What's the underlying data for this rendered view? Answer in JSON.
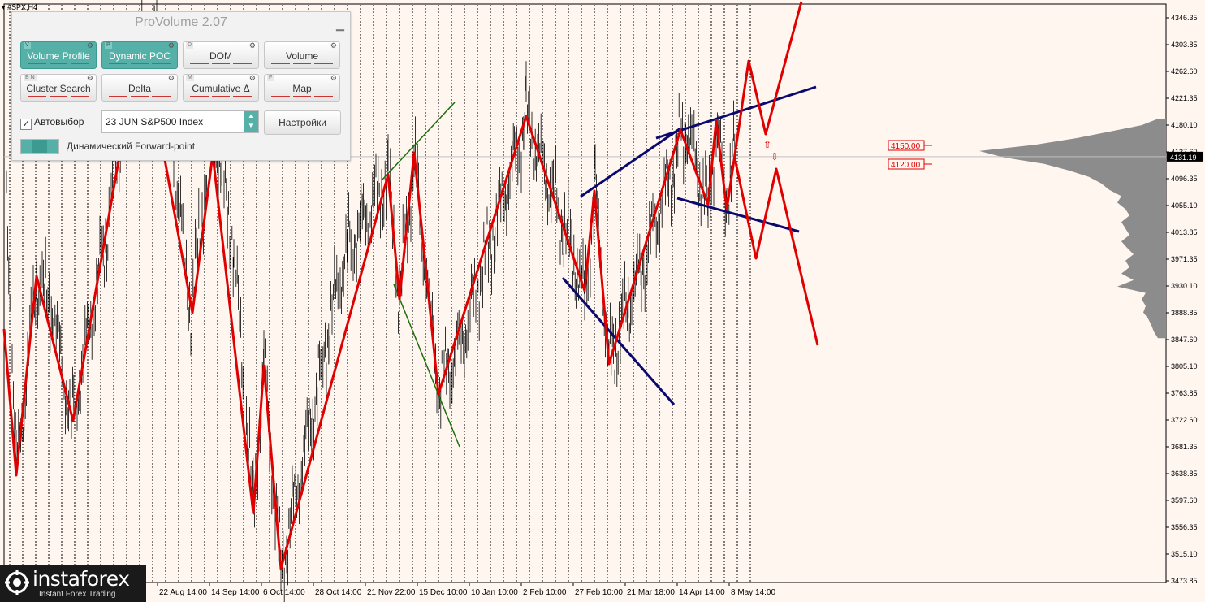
{
  "symbol_tab": "#SPX,H4",
  "panel": {
    "title": "ProVolume 2.07",
    "minimize_icon": "minimize-icon",
    "buttons": [
      {
        "key": "V",
        "label": "Volume Profile",
        "active": true
      },
      {
        "key": "P",
        "label": "Dynamic POC",
        "active": true
      },
      {
        "key": "D",
        "label": "DOM",
        "active": false
      },
      {
        "key": "",
        "label": "Volume",
        "active": false
      },
      {
        "key": "B N",
        "label": "Cluster Search",
        "active": false
      },
      {
        "key": "",
        "label": "Delta",
        "active": false
      },
      {
        "key": "M",
        "label": "Cumulative Δ",
        "active": false
      },
      {
        "key": "F",
        "label": "Map",
        "active": false
      }
    ],
    "autoselect_label": "Автовыбор",
    "autoselect_checked": true,
    "symbol_value": "23 JUN S&P500 Index",
    "settings_label": "Настройки",
    "forward_label": "Динамический Forward-point"
  },
  "price_axis": {
    "labels": [
      "4346.35",
      "4303.85",
      "4262.60",
      "4221.35",
      "4180.10",
      "4137.60",
      "4096.35",
      "4055.10",
      "4013.85",
      "3971.35",
      "3930.10",
      "3888.85",
      "3847.60",
      "3805.10",
      "3763.85",
      "3722.60",
      "3681.35",
      "3638.85",
      "3597.60",
      "3556.35",
      "3515.10",
      "3473.85"
    ],
    "current_price": "4131.19"
  },
  "date_axis": {
    "labels": [
      "22 Aug 14:00",
      "14 Sep 14:00",
      "6 Oct 14:00",
      "28 Oct 14:00",
      "21 Nov 22:00",
      "15 Dec 10:00",
      "10 Jan 10:00",
      "2 Feb 10:00",
      "27 Feb 10:00",
      "21 Mar 18:00",
      "14 Apr 14:00",
      "8 May 14:00"
    ]
  },
  "level_labels": [
    {
      "text": "4150.00",
      "price": 4150.0
    },
    {
      "text": "4120.00",
      "price": 4120.0
    }
  ],
  "colors": {
    "background": "#fff6f0",
    "zigzag": "#e00000",
    "channel": "#0a0a6e",
    "green_lines": "#1e6e0a",
    "volume_profile": "#8c8c8c",
    "accent": "#55b1a8"
  },
  "watermark": {
    "brand": "instaforex",
    "tagline": "Instant Forex Trading"
  }
}
